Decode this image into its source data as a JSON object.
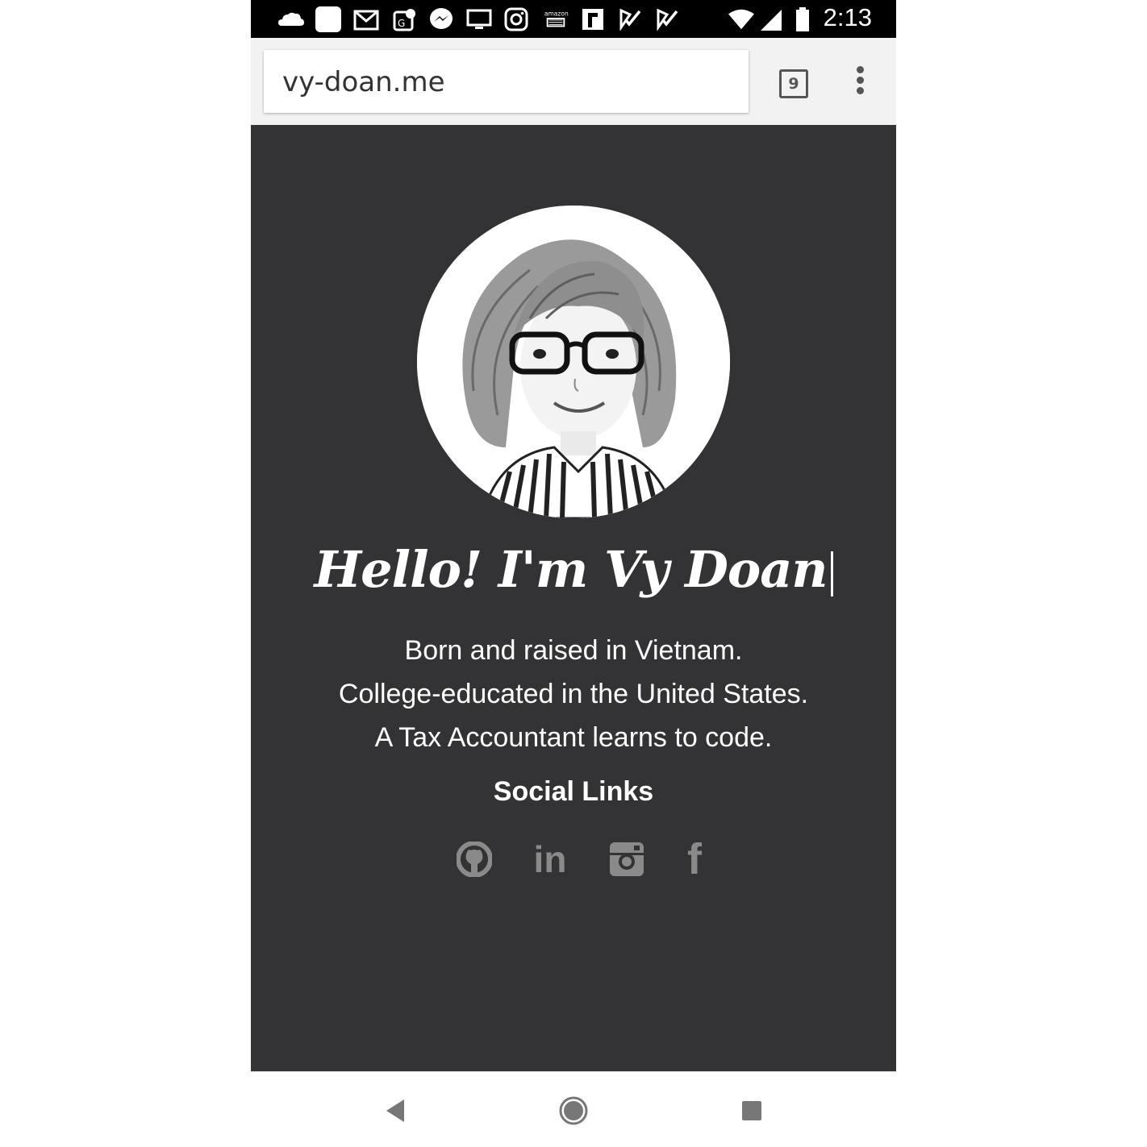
{
  "status_bar": {
    "time": "2:13",
    "icons": [
      "cloud-icon",
      "square-app-icon",
      "gmail-icon",
      "maps-icon",
      "messenger-icon",
      "tv-icon",
      "instagram-icon",
      "amazon-icon",
      "flipboard-icon",
      "check-icon",
      "check-icon",
      "wifi-icon",
      "signal-icon",
      "battery-icon"
    ]
  },
  "browser": {
    "url": "vy-doan.me",
    "tab_count": "9"
  },
  "hero": {
    "greeting": "Hello! I'm Vy Doan",
    "bio_lines": [
      "Born and raised in Vietnam.",
      "College-educated in the United States.",
      "A Tax Accountant learns to code."
    ]
  },
  "social": {
    "title": "Social Links",
    "links": [
      {
        "name": "github-icon"
      },
      {
        "name": "linkedin-icon",
        "glyph": "in"
      },
      {
        "name": "instagram-icon"
      },
      {
        "name": "facebook-icon",
        "glyph": "f"
      }
    ]
  },
  "colors": {
    "page_bg": "#333335",
    "text": "#ffffff",
    "icon_gray": "#8a8a8a",
    "status_bar": "#000000",
    "browser_bar": "#f2f2f2"
  }
}
